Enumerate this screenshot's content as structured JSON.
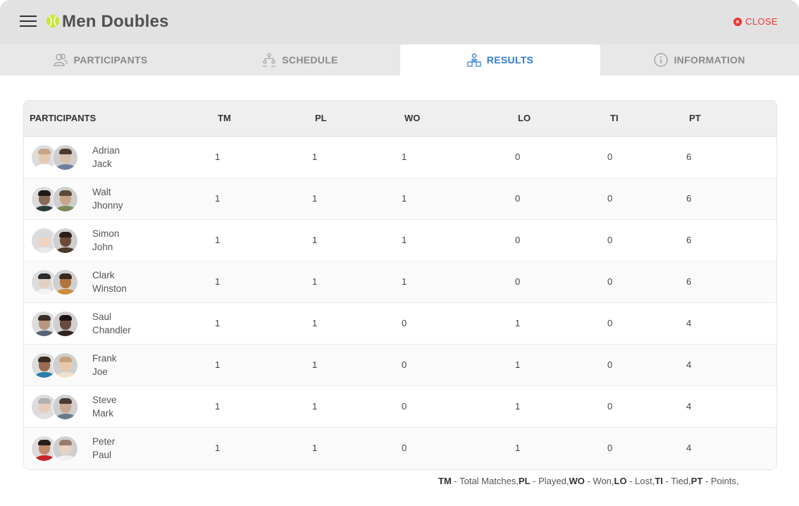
{
  "header": {
    "title": "Men Doubles",
    "close_label": "CLOSE"
  },
  "tabs": [
    {
      "label": "PARTICIPANTS",
      "icon": "participants-icon",
      "active": false
    },
    {
      "label": "SCHEDULE",
      "icon": "schedule-icon",
      "active": false
    },
    {
      "label": "RESULTS",
      "icon": "results-icon",
      "active": true
    },
    {
      "label": "INFORMATION",
      "icon": "info-icon",
      "active": false
    }
  ],
  "colors": {
    "accent": "#2f7bd1",
    "close": "#e53935",
    "header_bg": "#e2e2e2"
  },
  "table": {
    "columns": [
      "PARTICIPANTS",
      "TM",
      "PL",
      "WO",
      "LO",
      "TI",
      "PT"
    ],
    "rows": [
      {
        "p1": "Adrian",
        "p2": "Jack",
        "tm": "1",
        "pl": "1",
        "wo": "1",
        "lo": "0",
        "ti": "0",
        "pt": "6"
      },
      {
        "p1": "Walt",
        "p2": "Jhonny",
        "tm": "1",
        "pl": "1",
        "wo": "1",
        "lo": "0",
        "ti": "0",
        "pt": "6"
      },
      {
        "p1": "Simon",
        "p2": "John",
        "tm": "1",
        "pl": "1",
        "wo": "1",
        "lo": "0",
        "ti": "0",
        "pt": "6"
      },
      {
        "p1": "Clark",
        "p2": "Winston",
        "tm": "1",
        "pl": "1",
        "wo": "1",
        "lo": "0",
        "ti": "0",
        "pt": "6"
      },
      {
        "p1": "Saul",
        "p2": "Chandler",
        "tm": "1",
        "pl": "1",
        "wo": "0",
        "lo": "1",
        "ti": "0",
        "pt": "4"
      },
      {
        "p1": "Frank",
        "p2": "Joe",
        "tm": "1",
        "pl": "1",
        "wo": "0",
        "lo": "1",
        "ti": "0",
        "pt": "4"
      },
      {
        "p1": "Steve",
        "p2": "Mark",
        "tm": "1",
        "pl": "1",
        "wo": "0",
        "lo": "1",
        "ti": "0",
        "pt": "4"
      },
      {
        "p1": "Peter",
        "p2": "Paul",
        "tm": "1",
        "pl": "1",
        "wo": "0",
        "lo": "1",
        "ti": "0",
        "pt": "4"
      }
    ]
  },
  "legend": [
    {
      "abbr": "TM",
      "text": " - Total Matches,"
    },
    {
      "abbr": "PL",
      "text": " - Played,"
    },
    {
      "abbr": "WO",
      "text": " - Won,"
    },
    {
      "abbr": "LO",
      "text": " - Lost,"
    },
    {
      "abbr": "TI",
      "text": " - Tied,"
    },
    {
      "abbr": "PT",
      "text": " - Points,"
    }
  ]
}
